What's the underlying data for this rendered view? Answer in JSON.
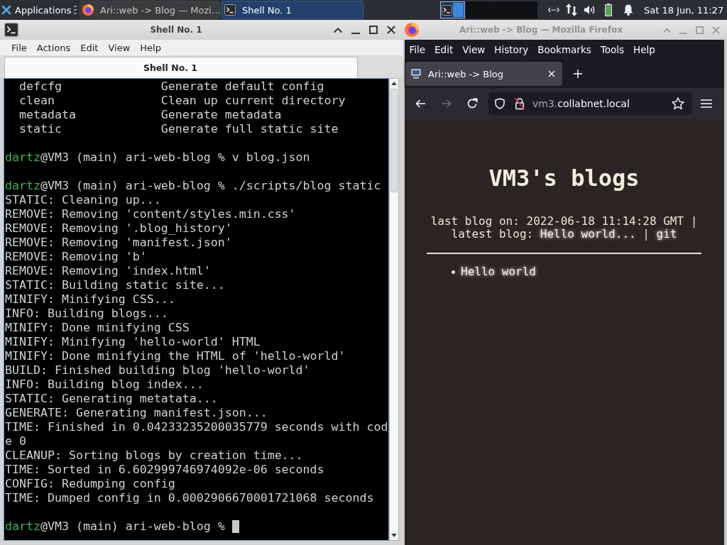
{
  "panel": {
    "menu_label": "Applications",
    "tasks": [
      {
        "kind": "browser",
        "title": "Ari::web -> Blog — Mozi…",
        "selected": false
      },
      {
        "kind": "terminal",
        "title": "Shell No. 1",
        "selected": true
      }
    ],
    "workspaces": [
      {
        "selected": true
      },
      {
        "selected": false
      },
      {
        "selected": false
      },
      {
        "selected": false
      }
    ],
    "clock": "Sat 18 Jun, 11:27"
  },
  "terminal_window": {
    "title": "Shell No. 1",
    "active": true,
    "menu": [
      "File",
      "Actions",
      "Edit",
      "View",
      "Help"
    ],
    "tabs": [
      {
        "label": "Shell No. 1",
        "selected": true
      }
    ],
    "lines": [
      {
        "kind": "help",
        "command": "defcfg",
        "description": "Generate default config"
      },
      {
        "kind": "help",
        "command": "clean",
        "description": "Clean up current directory"
      },
      {
        "kind": "help",
        "command": "metadata",
        "description": "Generate metadata"
      },
      {
        "kind": "help",
        "command": "static",
        "description": "Generate full static site"
      },
      {
        "kind": "blank"
      },
      {
        "kind": "prompt",
        "user": "dartz",
        "context": "@VM3 (main) ari-web-blog %",
        "command": "v blog.json",
        "cursor": false
      },
      {
        "kind": "blank"
      },
      {
        "kind": "prompt",
        "user": "dartz",
        "context": "@VM3 (main) ari-web-blog %",
        "command": "./scripts/blog static",
        "cursor": false
      },
      {
        "kind": "output",
        "text": "STATIC: Cleaning up..."
      },
      {
        "kind": "output",
        "text": "REMOVE: Removing 'content/styles.min.css'"
      },
      {
        "kind": "output",
        "text": "REMOVE: Removing '.blog_history'"
      },
      {
        "kind": "output",
        "text": "REMOVE: Removing 'manifest.json'"
      },
      {
        "kind": "output",
        "text": "REMOVE: Removing 'b'"
      },
      {
        "kind": "output",
        "text": "REMOVE: Removing 'index.html'"
      },
      {
        "kind": "output",
        "text": "STATIC: Building static site..."
      },
      {
        "kind": "output",
        "text": "MINIFY: Minifying CSS..."
      },
      {
        "kind": "output",
        "text": "INFO: Building blogs..."
      },
      {
        "kind": "output",
        "text": "MINIFY: Done minifying CSS"
      },
      {
        "kind": "output",
        "text": "MINIFY: Minifying 'hello-world' HTML"
      },
      {
        "kind": "output",
        "text": "MINIFY: Done minifying the HTML of 'hello-world'"
      },
      {
        "kind": "output",
        "text": "BUILD: Finished building blog 'hello-world'"
      },
      {
        "kind": "output",
        "text": "INFO: Building blog index..."
      },
      {
        "kind": "output",
        "text": "STATIC: Generating metatata..."
      },
      {
        "kind": "output",
        "text": "GENERATE: Generating manifest.json..."
      },
      {
        "kind": "output",
        "text": "TIME: Finished in 0.04233235200035779 seconds with code 0"
      },
      {
        "kind": "output",
        "text": "CLEANUP: Sorting blogs by creation time..."
      },
      {
        "kind": "output",
        "text": "TIME: Sorted in 6.602999746974092e-06 seconds"
      },
      {
        "kind": "output",
        "text": "CONFIG: Redumping config"
      },
      {
        "kind": "output",
        "text": "TIME: Dumped config in 0.0002906670001721068 seconds"
      },
      {
        "kind": "blank"
      },
      {
        "kind": "prompt",
        "user": "dartz",
        "context": "@VM3 (main) ari-web-blog %",
        "cursor": true
      }
    ]
  },
  "browser_window": {
    "title": "Ari::web -> Blog — Mozilla Firefox",
    "active": false,
    "menu": [
      "File",
      "Edit",
      "View",
      "History",
      "Bookmarks",
      "Tools",
      "Help"
    ],
    "tabs": [
      {
        "label": "Ari::web -> Blog",
        "selected": true
      }
    ],
    "navigation": {
      "back_disabled": false,
      "forward_disabled": true
    },
    "url": {
      "subdomain": "vm3.",
      "domain": "collabnet.local"
    },
    "page": {
      "heading": "VM3's blogs",
      "info": {
        "last_blog": "last blog on: 2022-06-18 11:14:28 GMT |",
        "latest_label": "latest blog:",
        "latest_link": "Hello world...",
        "separator": "|",
        "source_link": "git"
      },
      "posts": [
        {
          "title": "Hello world"
        }
      ]
    }
  }
}
